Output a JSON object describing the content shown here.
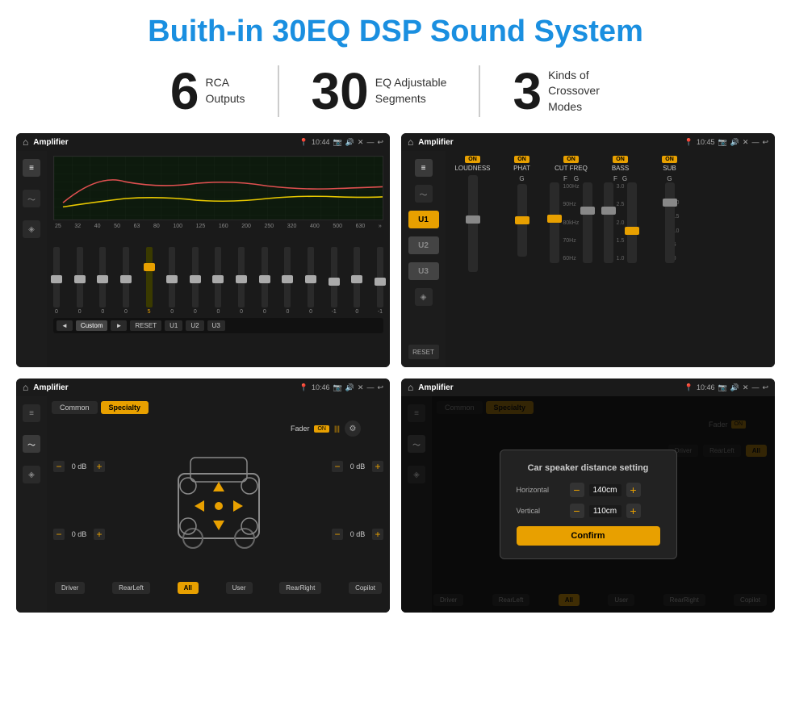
{
  "header": {
    "title": "Buith-in 30EQ DSP Sound System"
  },
  "stats": [
    {
      "number": "6",
      "label": "RCA\nOutputs"
    },
    {
      "number": "30",
      "label": "EQ Adjustable\nSegments"
    },
    {
      "number": "3",
      "label": "Kinds of\nCrossover Modes"
    }
  ],
  "screens": [
    {
      "id": "screen1",
      "topbar": {
        "title": "Amplifier",
        "time": "10:44"
      },
      "type": "eq"
    },
    {
      "id": "screen2",
      "topbar": {
        "title": "Amplifier",
        "time": "10:45"
      },
      "type": "crossover"
    },
    {
      "id": "screen3",
      "topbar": {
        "title": "Amplifier",
        "time": "10:46"
      },
      "type": "fader"
    },
    {
      "id": "screen4",
      "topbar": {
        "title": "Amplifier",
        "time": "10:46"
      },
      "type": "dialog"
    }
  ],
  "eq": {
    "frequencies": [
      "25",
      "32",
      "40",
      "50",
      "63",
      "80",
      "100",
      "125",
      "160",
      "200",
      "250",
      "320",
      "400",
      "500",
      "630"
    ],
    "values": [
      "0",
      "0",
      "0",
      "0",
      "5",
      "0",
      "0",
      "0",
      "0",
      "0",
      "0",
      "0",
      "-1",
      "0",
      "-1"
    ],
    "preset": "Custom",
    "buttons": [
      "◄",
      "Custom",
      "►",
      "RESET",
      "U1",
      "U2",
      "U3"
    ]
  },
  "crossover": {
    "channels": [
      "U1",
      "U2",
      "U3"
    ],
    "sections": [
      {
        "label": "LOUDNESS",
        "on": true
      },
      {
        "label": "PHAT",
        "on": true
      },
      {
        "label": "CUT FREQ",
        "on": true
      },
      {
        "label": "BASS",
        "on": true
      },
      {
        "label": "SUB",
        "on": true
      }
    ]
  },
  "fader": {
    "tabs": [
      "Common",
      "Specialty"
    ],
    "fader_label": "Fader",
    "db_values": [
      "0 dB",
      "0 dB",
      "0 dB",
      "0 dB"
    ],
    "bottom_buttons": [
      "Driver",
      "RearLeft",
      "All",
      "User",
      "RearRight",
      "Copilot"
    ]
  },
  "dialog": {
    "title": "Car speaker distance setting",
    "horizontal_label": "Horizontal",
    "horizontal_value": "140cm",
    "vertical_label": "Vertical",
    "vertical_value": "110cm",
    "confirm_label": "Confirm"
  }
}
